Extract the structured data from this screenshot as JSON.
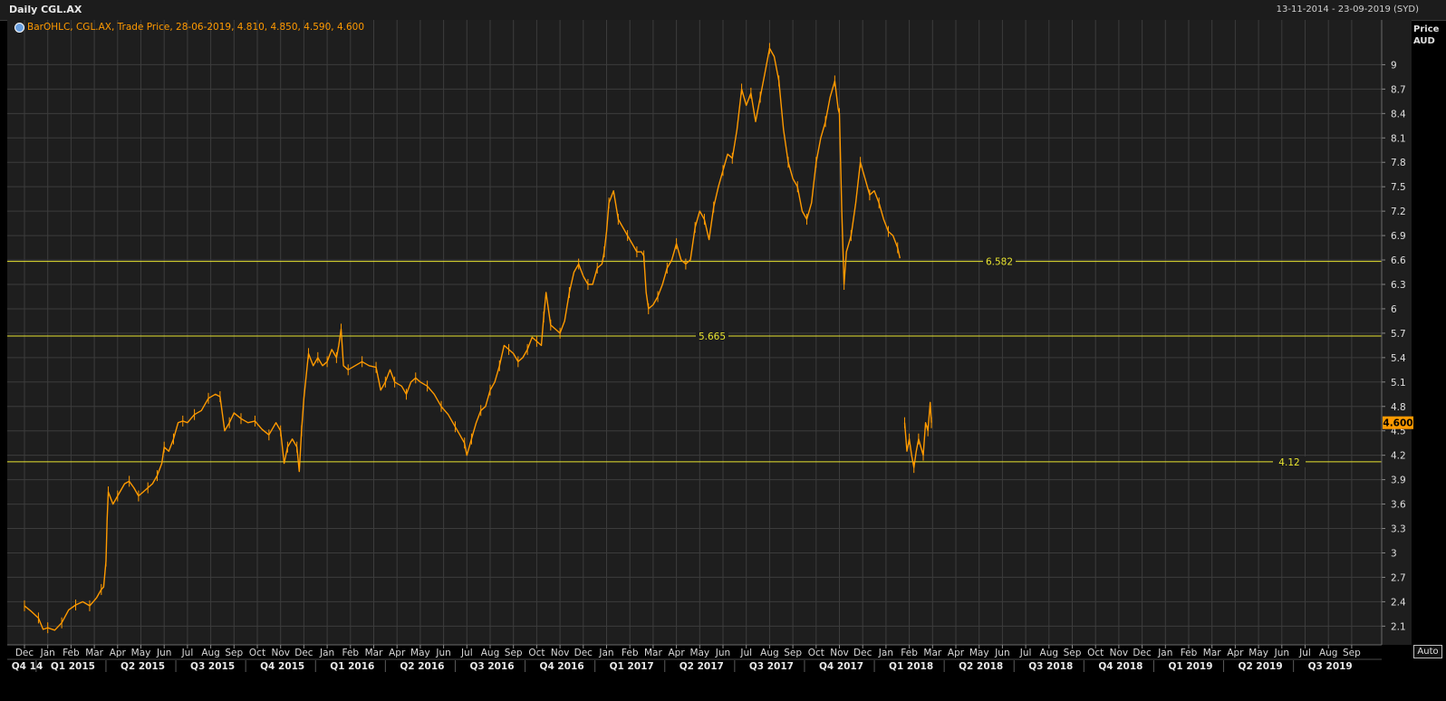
{
  "header": {
    "title": "Daily CGL.AX",
    "date_range": "13-11-2014 - 23-09-2019 (SYD)"
  },
  "legend": {
    "text": "BarOHLC, CGL.AX, Trade Price, 28-06-2019, 4.810, 4.850, 4.590, 4.600"
  },
  "axis": {
    "unit_line1": "Price",
    "unit_line2": "AUD",
    "auto_label": "Auto"
  },
  "colors": {
    "background": "#1e1e1e",
    "grid": "#3c3c3c",
    "price": "#ff9a00",
    "hline": "#e8e430",
    "last_price_tag": "#ff9a00"
  },
  "chart_data": {
    "type": "line",
    "title": "Daily CGL.AX",
    "ylabel": "Price AUD",
    "ylim": [
      1.87,
      9.55
    ],
    "y_ticks": [
      2.1,
      2.4,
      2.7,
      3,
      3.3,
      3.6,
      3.9,
      4.2,
      4.5,
      4.8,
      5.1,
      5.4,
      5.7,
      6,
      6.3,
      6.6,
      6.9,
      7.2,
      7.5,
      7.8,
      8.1,
      8.4,
      8.7,
      9
    ],
    "x_month_labels": [
      "Dec",
      "Jan",
      "Feb",
      "Mar",
      "Apr",
      "May",
      "Jun",
      "Jul",
      "Aug",
      "Sep",
      "Oct",
      "Nov",
      "Dec",
      "Jan",
      "Feb",
      "Mar",
      "Apr",
      "May",
      "Jun",
      "Jul",
      "Aug",
      "Sep",
      "Oct",
      "Nov",
      "Dec",
      "Jan",
      "Feb",
      "Mar",
      "Apr",
      "May",
      "Jun",
      "Jul",
      "Aug",
      "Sep",
      "Oct",
      "Nov",
      "Dec",
      "Jan",
      "Feb",
      "Mar",
      "Apr",
      "May",
      "Jun",
      "Jul",
      "Aug",
      "Sep",
      "Oct",
      "Nov",
      "Dec",
      "Jan",
      "Feb",
      "Mar",
      "Apr",
      "May",
      "Jun",
      "Jul",
      "Aug",
      "Sep"
    ],
    "x_quarter_labels": [
      "Q4 14",
      "Q1 2015",
      "Q2 2015",
      "Q3 2015",
      "Q4 2015",
      "Q1 2016",
      "Q2 2016",
      "Q3 2016",
      "Q4 2016",
      "Q1 2017",
      "Q2 2017",
      "Q3 2017",
      "Q4 2017",
      "Q1 2018",
      "Q2 2018",
      "Q3 2018",
      "Q4 2018",
      "Q1 2019",
      "Q2 2019",
      "Q3 2019"
    ],
    "grid": true,
    "series": [
      {
        "points": [
          [
            0,
            2.35
          ],
          [
            0.3,
            2.28
          ],
          [
            0.6,
            2.2
          ],
          [
            0.8,
            2.06
          ],
          [
            1.0,
            2.08
          ],
          [
            1.3,
            2.05
          ],
          [
            1.6,
            2.14
          ],
          [
            1.9,
            2.3
          ],
          [
            2.2,
            2.36
          ],
          [
            2.5,
            2.4
          ],
          [
            2.8,
            2.35
          ],
          [
            3.1,
            2.45
          ],
          [
            3.3,
            2.55
          ],
          [
            3.4,
            2.58
          ],
          [
            3.5,
            2.9
          ],
          [
            3.55,
            3.4
          ],
          [
            3.6,
            3.75
          ],
          [
            3.8,
            3.6
          ],
          [
            4.0,
            3.7
          ],
          [
            4.3,
            3.85
          ],
          [
            4.5,
            3.88
          ],
          [
            4.7,
            3.8
          ],
          [
            4.9,
            3.7
          ],
          [
            5.1,
            3.75
          ],
          [
            5.3,
            3.8
          ],
          [
            5.5,
            3.85
          ],
          [
            5.7,
            3.95
          ],
          [
            5.9,
            4.1
          ],
          [
            6.0,
            4.3
          ],
          [
            6.2,
            4.25
          ],
          [
            6.4,
            4.4
          ],
          [
            6.6,
            4.6
          ],
          [
            6.8,
            4.62
          ],
          [
            7.0,
            4.6
          ],
          [
            7.3,
            4.7
          ],
          [
            7.6,
            4.75
          ],
          [
            7.9,
            4.9
          ],
          [
            8.2,
            4.95
          ],
          [
            8.4,
            4.92
          ],
          [
            8.6,
            4.5
          ],
          [
            8.8,
            4.6
          ],
          [
            9.0,
            4.72
          ],
          [
            9.3,
            4.65
          ],
          [
            9.6,
            4.6
          ],
          [
            9.9,
            4.62
          ],
          [
            10.2,
            4.52
          ],
          [
            10.5,
            4.45
          ],
          [
            10.8,
            4.6
          ],
          [
            11.0,
            4.5
          ],
          [
            11.15,
            4.1
          ],
          [
            11.3,
            4.3
          ],
          [
            11.5,
            4.4
          ],
          [
            11.7,
            4.3
          ],
          [
            11.8,
            4.0
          ],
          [
            11.9,
            4.5
          ],
          [
            12.0,
            4.9
          ],
          [
            12.2,
            5.45
          ],
          [
            12.4,
            5.3
          ],
          [
            12.6,
            5.4
          ],
          [
            12.8,
            5.3
          ],
          [
            13.0,
            5.35
          ],
          [
            13.2,
            5.5
          ],
          [
            13.4,
            5.4
          ],
          [
            13.5,
            5.55
          ],
          [
            13.6,
            5.75
          ],
          [
            13.7,
            5.3
          ],
          [
            13.9,
            5.25
          ],
          [
            14.2,
            5.3
          ],
          [
            14.5,
            5.35
          ],
          [
            14.8,
            5.3
          ],
          [
            15.1,
            5.28
          ],
          [
            15.3,
            5.0
          ],
          [
            15.5,
            5.1
          ],
          [
            15.7,
            5.25
          ],
          [
            15.9,
            5.1
          ],
          [
            16.2,
            5.05
          ],
          [
            16.4,
            4.95
          ],
          [
            16.6,
            5.1
          ],
          [
            16.8,
            5.15
          ],
          [
            17.0,
            5.1
          ],
          [
            17.3,
            5.05
          ],
          [
            17.6,
            4.95
          ],
          [
            17.9,
            4.8
          ],
          [
            18.2,
            4.7
          ],
          [
            18.5,
            4.55
          ],
          [
            18.7,
            4.45
          ],
          [
            18.9,
            4.35
          ],
          [
            19.0,
            4.2
          ],
          [
            19.2,
            4.4
          ],
          [
            19.4,
            4.6
          ],
          [
            19.6,
            4.75
          ],
          [
            19.8,
            4.8
          ],
          [
            20.0,
            5.0
          ],
          [
            20.2,
            5.1
          ],
          [
            20.4,
            5.3
          ],
          [
            20.6,
            5.55
          ],
          [
            20.8,
            5.5
          ],
          [
            21.0,
            5.45
          ],
          [
            21.2,
            5.35
          ],
          [
            21.4,
            5.4
          ],
          [
            21.6,
            5.5
          ],
          [
            21.8,
            5.65
          ],
          [
            22.0,
            5.6
          ],
          [
            22.2,
            5.55
          ],
          [
            22.3,
            5.9
          ],
          [
            22.4,
            6.2
          ],
          [
            22.6,
            5.8
          ],
          [
            22.8,
            5.75
          ],
          [
            23.0,
            5.7
          ],
          [
            23.2,
            5.85
          ],
          [
            23.4,
            6.2
          ],
          [
            23.6,
            6.45
          ],
          [
            23.8,
            6.55
          ],
          [
            24.0,
            6.4
          ],
          [
            24.2,
            6.3
          ],
          [
            24.4,
            6.3
          ],
          [
            24.6,
            6.5
          ],
          [
            24.8,
            6.55
          ],
          [
            24.9,
            6.7
          ],
          [
            25.0,
            6.95
          ],
          [
            25.1,
            7.3
          ],
          [
            25.3,
            7.45
          ],
          [
            25.5,
            7.1
          ],
          [
            25.7,
            7.0
          ],
          [
            25.9,
            6.9
          ],
          [
            26.1,
            6.8
          ],
          [
            26.3,
            6.7
          ],
          [
            26.5,
            6.7
          ],
          [
            26.6,
            6.65
          ],
          [
            26.7,
            6.2
          ],
          [
            26.8,
            6.0
          ],
          [
            27.0,
            6.05
          ],
          [
            27.2,
            6.15
          ],
          [
            27.4,
            6.3
          ],
          [
            27.6,
            6.5
          ],
          [
            27.8,
            6.6
          ],
          [
            28.0,
            6.8
          ],
          [
            28.2,
            6.6
          ],
          [
            28.4,
            6.55
          ],
          [
            28.6,
            6.6
          ],
          [
            28.8,
            7.0
          ],
          [
            29.0,
            7.2
          ],
          [
            29.2,
            7.1
          ],
          [
            29.4,
            6.85
          ],
          [
            29.6,
            7.25
          ],
          [
            29.8,
            7.5
          ],
          [
            30.0,
            7.7
          ],
          [
            30.2,
            7.9
          ],
          [
            30.4,
            7.85
          ],
          [
            30.6,
            8.2
          ],
          [
            30.8,
            8.7
          ],
          [
            31.0,
            8.5
          ],
          [
            31.2,
            8.65
          ],
          [
            31.4,
            8.3
          ],
          [
            31.6,
            8.6
          ],
          [
            31.8,
            8.9
          ],
          [
            32.0,
            9.2
          ],
          [
            32.2,
            9.1
          ],
          [
            32.4,
            8.8
          ],
          [
            32.6,
            8.2
          ],
          [
            32.8,
            7.8
          ],
          [
            33.0,
            7.6
          ],
          [
            33.2,
            7.5
          ],
          [
            33.4,
            7.2
          ],
          [
            33.6,
            7.1
          ],
          [
            33.8,
            7.3
          ],
          [
            34.0,
            7.8
          ],
          [
            34.2,
            8.1
          ],
          [
            34.4,
            8.3
          ],
          [
            34.6,
            8.6
          ],
          [
            34.8,
            8.8
          ],
          [
            34.95,
            8.45
          ],
          [
            35.0,
            8.4
          ],
          [
            35.1,
            7.2
          ],
          [
            35.2,
            6.3
          ],
          [
            35.3,
            6.7
          ],
          [
            35.5,
            6.9
          ],
          [
            35.7,
            7.3
          ],
          [
            35.9,
            7.8
          ],
          [
            36.1,
            7.6
          ],
          [
            36.3,
            7.4
          ],
          [
            36.5,
            7.45
          ],
          [
            36.7,
            7.3
          ],
          [
            36.9,
            7.1
          ],
          [
            37.1,
            6.95
          ],
          [
            37.3,
            6.9
          ],
          [
            37.5,
            6.75
          ],
          [
            37.6,
            6.62
          ],
          null,
          [
            37.8,
            4.6
          ],
          [
            37.9,
            4.25
          ],
          [
            38.0,
            4.4
          ],
          [
            38.1,
            4.2
          ],
          [
            38.2,
            4.05
          ],
          [
            38.3,
            4.25
          ],
          [
            38.4,
            4.4
          ],
          [
            38.5,
            4.3
          ],
          [
            38.6,
            4.2
          ],
          [
            38.7,
            4.6
          ],
          [
            38.8,
            4.5
          ],
          [
            38.9,
            4.85
          ],
          [
            38.95,
            4.6
          ]
        ]
      }
    ],
    "reference_lines": [
      {
        "value": 6.582,
        "label": "6.582"
      },
      {
        "value": 5.665,
        "label": "5.665"
      },
      {
        "value": 4.12,
        "label": "4.12"
      }
    ],
    "last_price": {
      "value": 4.6,
      "label": "4.600"
    }
  }
}
